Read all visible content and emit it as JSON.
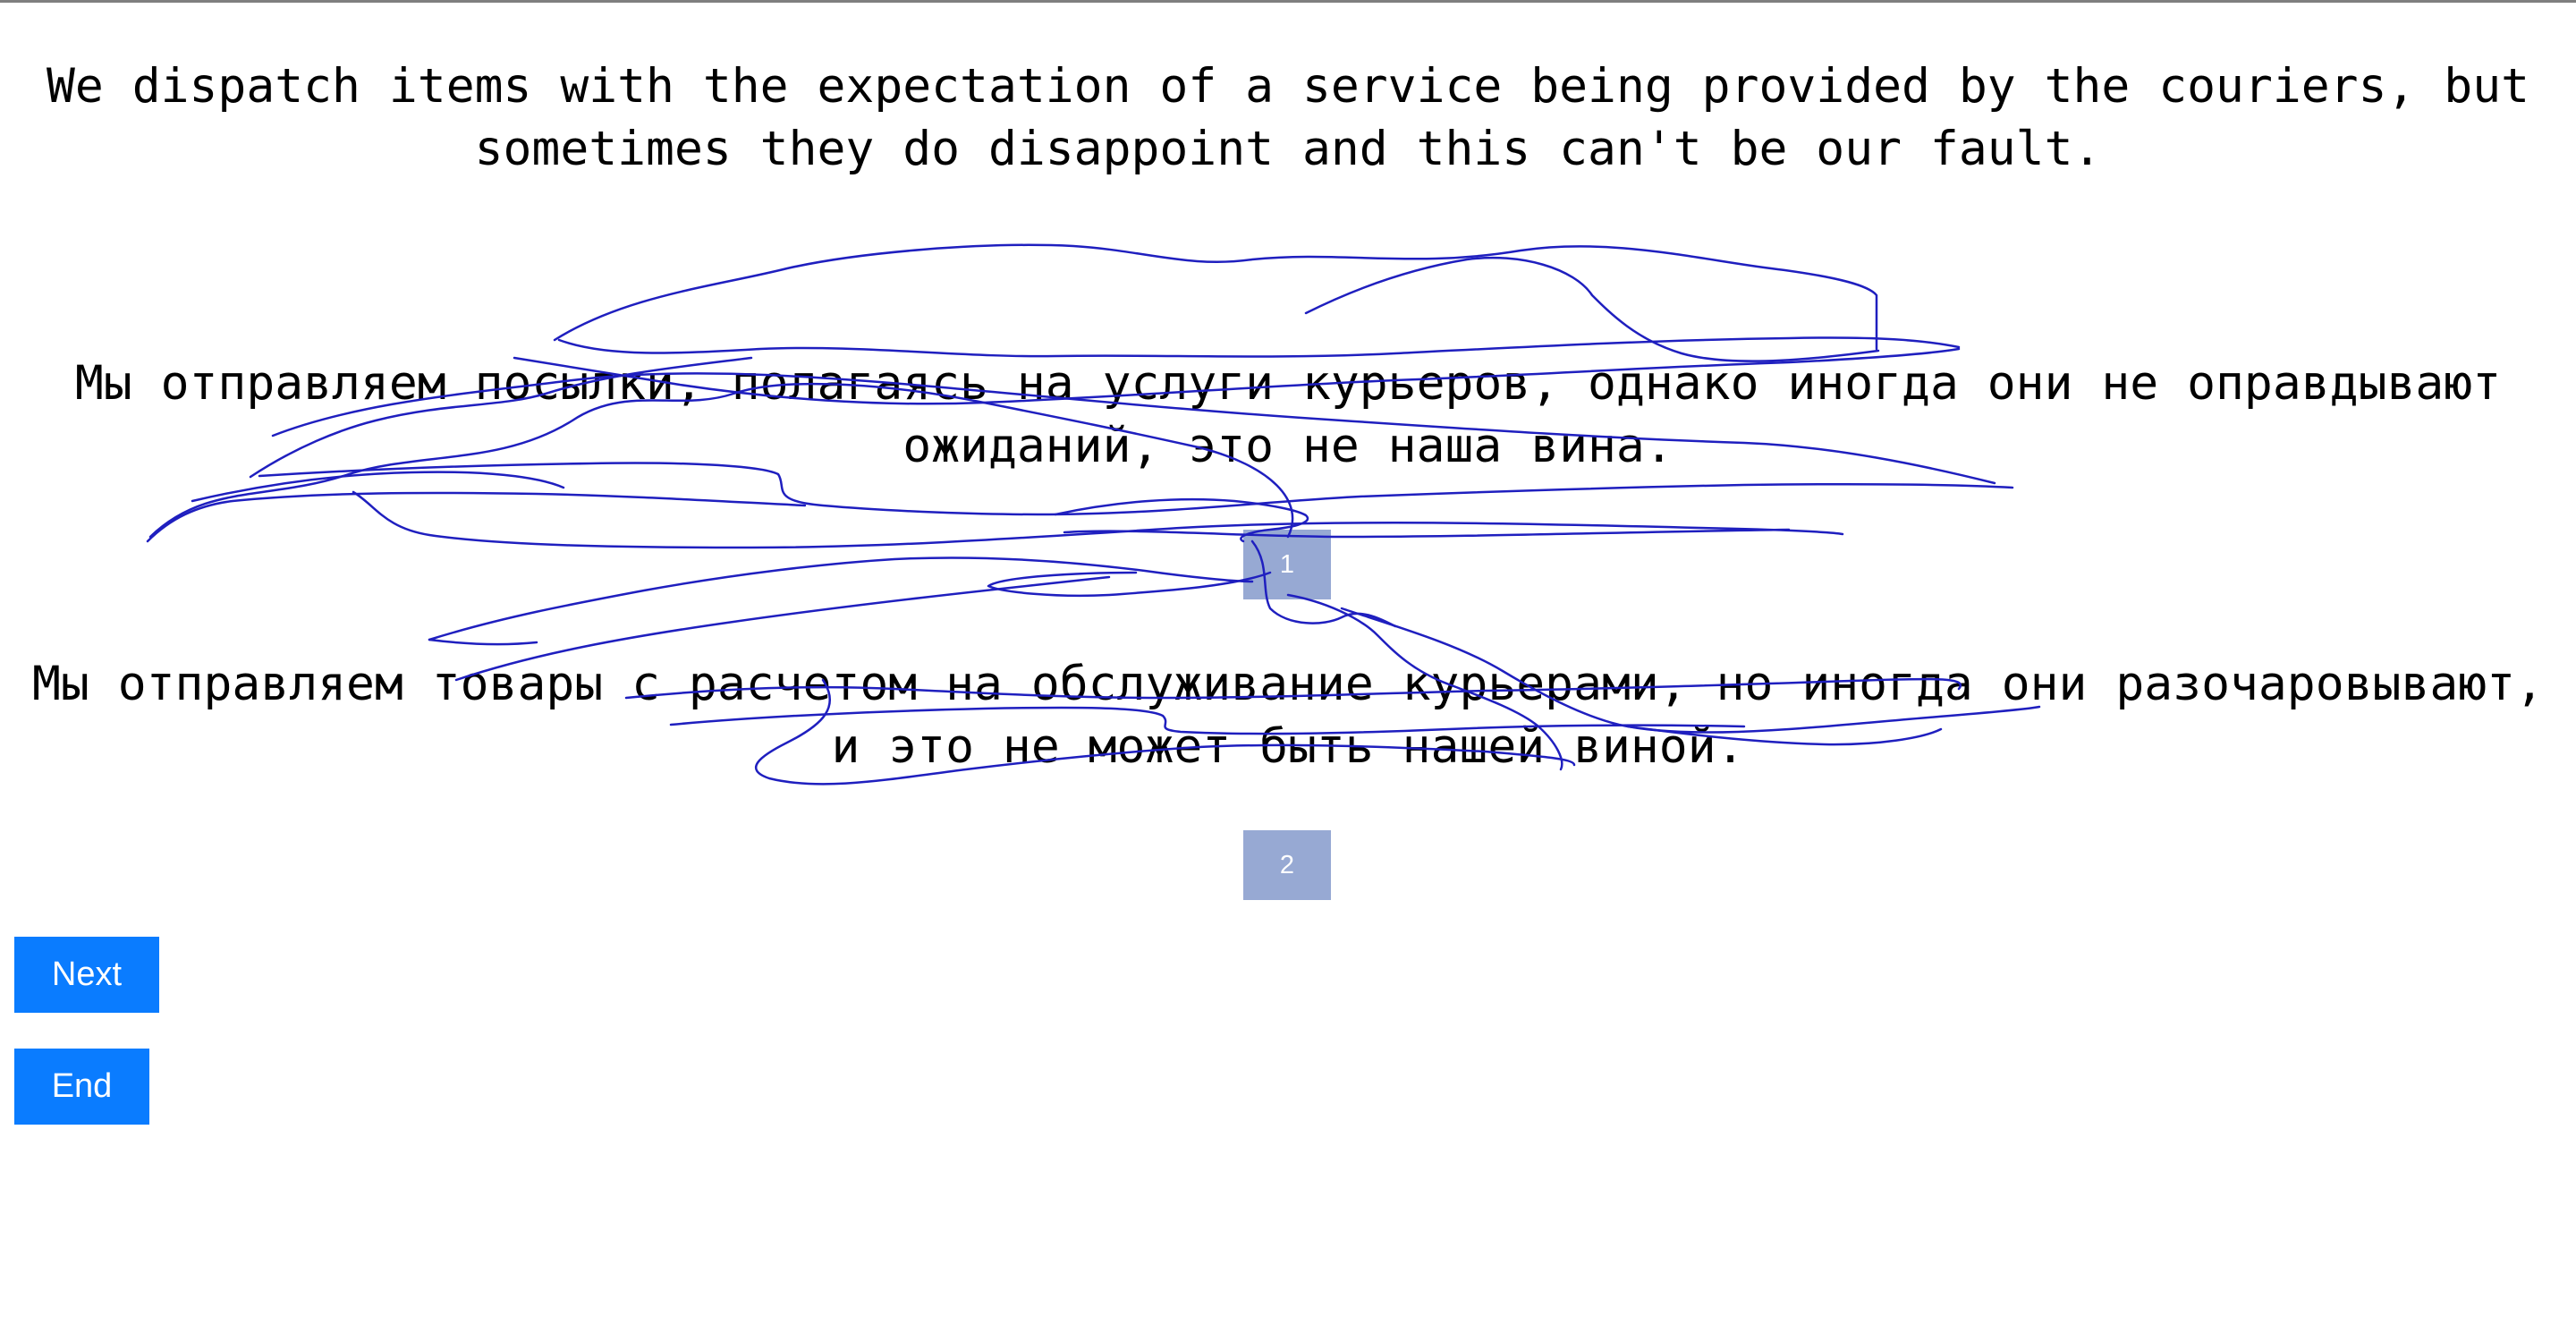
{
  "source": {
    "text": "We dispatch items with the expectation of a service being provided by the couriers, but sometimes they do disappoint and this can't be our fault."
  },
  "options": [
    {
      "text": "Мы отправляем посылки, полагаясь на услуги курьеров, однако иногда они не оправдывают ожиданий, это не наша вина.",
      "choice_label": "1"
    },
    {
      "text": "Мы отправляем товары с расчетом на обслуживание курьерами, но иногда они разочаровывают, и это не может быть нашей виной.",
      "choice_label": "2"
    }
  ],
  "controls": {
    "next_label": "Next",
    "end_label": "End"
  },
  "colors": {
    "choice_box": "#97a9d3",
    "button": "#0a7cff",
    "scribble": "#1f1fbf"
  }
}
